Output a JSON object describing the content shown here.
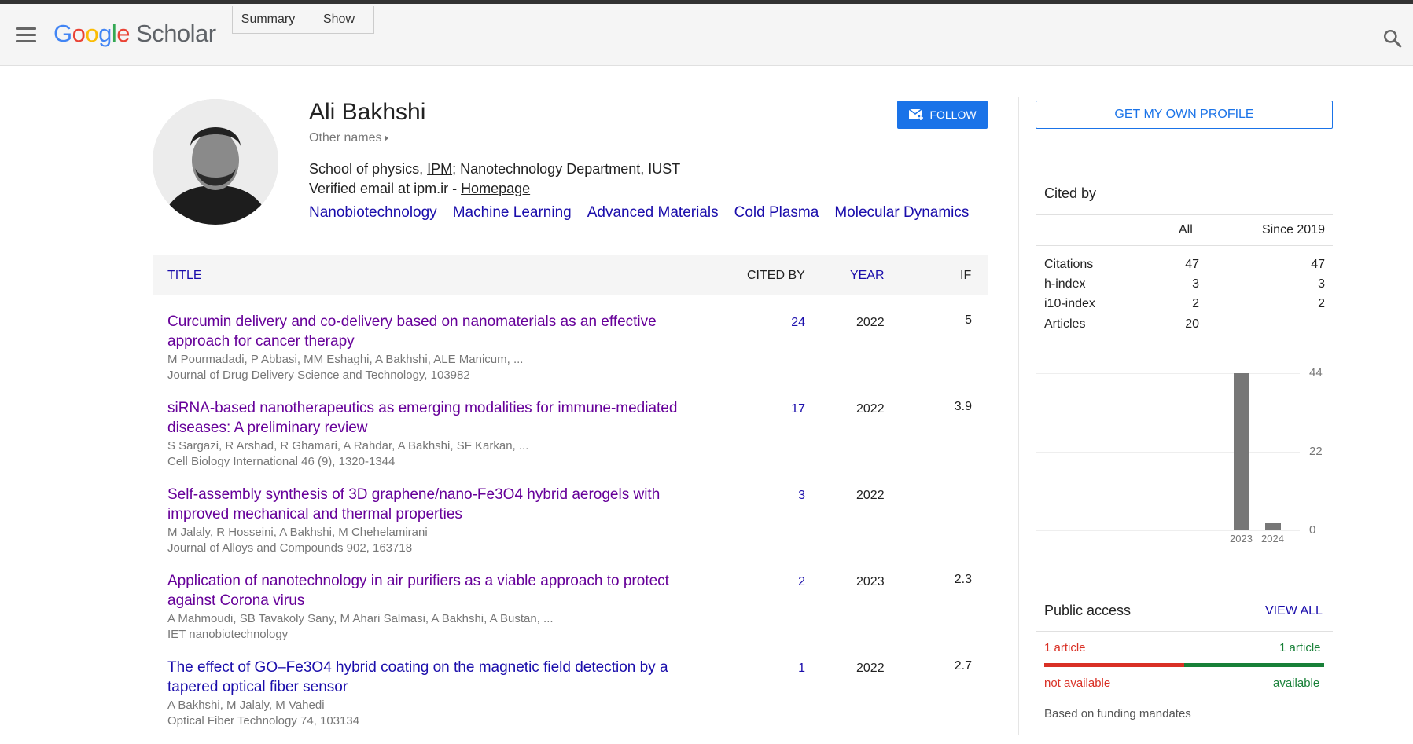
{
  "header": {
    "logo_parts": [
      "G",
      "o",
      "o",
      "g",
      "l",
      "e"
    ],
    "logo_product": "Scholar",
    "tabs": [
      "Summary",
      "Show"
    ]
  },
  "profile": {
    "name": "Ali Bakhshi",
    "other_names": "Other names",
    "affiliation_pre": "School of physics, ",
    "affiliation_link": "IPM",
    "affiliation_post": "; Nanotechnology Department, IUST",
    "email_text": "Verified email at ipm.ir - ",
    "homepage": "Homepage",
    "interests": [
      "Nanobiotechnology",
      "Machine Learning",
      "Advanced Materials",
      "Cold Plasma",
      "Molecular Dynamics"
    ],
    "follow_label": "FOLLOW"
  },
  "table": {
    "headers": {
      "title": "TITLE",
      "cited_by": "CITED BY",
      "year": "YEAR",
      "if": "IF"
    },
    "rows": [
      {
        "title": "Curcumin delivery and co-delivery based on nanomaterials as an effective approach for cancer therapy",
        "authors": "M Pourmadadi, P Abbasi, MM Eshaghi, A Bakhshi, ALE Manicum, ...",
        "venue": "Journal of Drug Delivery Science and Technology, 103982",
        "cited": "24",
        "year": "2022",
        "if": "5"
      },
      {
        "title": "siRNA-based nanotherapeutics as emerging modalities for immune-mediated diseases: A preliminary review",
        "authors": "S Sargazi, R Arshad, R Ghamari, A Rahdar, A Bakhshi, SF Karkan, ...",
        "venue": "Cell Biology International 46 (9), 1320-1344",
        "cited": "17",
        "year": "2022",
        "if": "3.9"
      },
      {
        "title": "Self-assembly synthesis of 3D graphene/nano-Fe3O4 hybrid aerogels with improved mechanical and thermal properties",
        "authors": "M Jalaly, R Hosseini, A Bakhshi, M Chehelamirani",
        "venue": "Journal of Alloys and Compounds 902, 163718",
        "cited": "3",
        "year": "2022",
        "if": ""
      },
      {
        "title": "Application of nanotechnology in air purifiers as a viable approach to protect against Corona virus",
        "authors": "A Mahmoudi, SB Tavakoly Sany, M Ahari Salmasi, A Bakhshi, A Bustan, ...",
        "venue": "IET nanobiotechnology",
        "cited": "2",
        "year": "2023",
        "if": "2.3"
      },
      {
        "title": "The effect of GO–Fe3O4 hybrid coating on the magnetic field detection by a tapered optical fiber sensor",
        "authors": "A Bakhshi, M Jalaly, M Vahedi",
        "venue": "Optical Fiber Technology 74, 103134",
        "cited": "1",
        "year": "2022",
        "if": "2.7"
      }
    ]
  },
  "sidebar": {
    "get_profile": "GET MY OWN PROFILE",
    "cited_by_title": "Cited by",
    "col_all": "All",
    "col_since": "Since 2019",
    "stats": [
      {
        "label": "Citations",
        "all": "47",
        "since": "47"
      },
      {
        "label": "h-index",
        "all": "3",
        "since": "3"
      },
      {
        "label": "i10-index",
        "all": "2",
        "since": "2"
      },
      {
        "label": "Articles",
        "all": "20",
        "since": ""
      }
    ],
    "public_access_title": "Public access",
    "view_all": "VIEW ALL",
    "pa_left": "1 article",
    "pa_right": "1 article",
    "not_available": "not available",
    "available": "available",
    "funding_note": "Based on funding mandates"
  },
  "chart_data": {
    "type": "bar",
    "categories": [
      "2023",
      "2024"
    ],
    "values": [
      44,
      2
    ],
    "yticks": [
      "44",
      "22",
      "0"
    ],
    "ylim": [
      0,
      44
    ],
    "title": "",
    "xlabel": "",
    "ylabel": ""
  },
  "colors": {
    "link": "#1a0dab",
    "visited": "#660099",
    "accent": "#1a73e8",
    "red": "#d93025",
    "green": "#188038"
  }
}
